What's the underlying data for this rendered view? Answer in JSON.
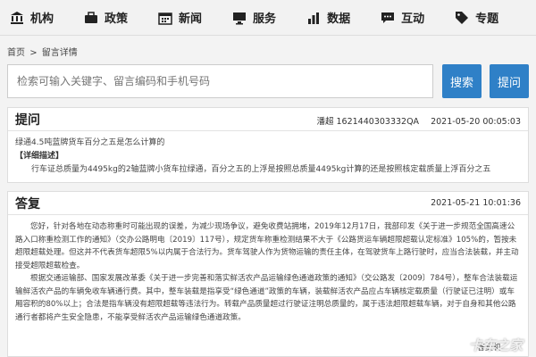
{
  "nav": {
    "items": [
      {
        "label": "机构",
        "icon": "institution-icon"
      },
      {
        "label": "政策",
        "icon": "briefcase-icon"
      },
      {
        "label": "新闻",
        "icon": "calendar-icon"
      },
      {
        "label": "服务",
        "icon": "monitor-icon"
      },
      {
        "label": "数据",
        "icon": "bar-chart-icon"
      },
      {
        "label": "互动",
        "icon": "chat-bubble-icon"
      },
      {
        "label": "专题",
        "icon": "tag-icon"
      }
    ]
  },
  "breadcrumb": {
    "home": "首页",
    "sep": ">",
    "current": "留言详情"
  },
  "search": {
    "placeholder": "检索可输入关键字、留言编码和手机号码",
    "search_label": "搜索",
    "ask_label": "提问"
  },
  "question": {
    "heading": "提问",
    "code": "潘超 1621440303332QA",
    "date": "2021-05-20 00:05:03",
    "title": "绿通4.5吨蓝牌货车百分之五是怎么计算的",
    "desc_label": "【详细描述】",
    "desc": "行车证总质量为4495kg的2轴蓝牌小货车拉绿通，百分之五的上浮是按照总质量4495kg计算的还是按照核定载质量上浮百分之五"
  },
  "answer": {
    "heading": "答复",
    "date": "2021-05-21 10:01:36",
    "paragraphs": [
      "您好，针对各地在动态称重时可能出现的误差，为减少现场争议，避免收费站拥堵，2019年12月17日，我部印发《关于进一步规范全国高速公路入口称重检测工作的通知》（交办公路明电〔2019〕117号），规定货车称重检测结果不大于《公路货运车辆超限超载认定标准》105%的，暂按未超限超载处理。但这并不代表货车超限5%以内属于合法行为。货车驾驶人作为货物运输的责任主体，在驾驶货车上路行驶时，应当合法装载，并主动接受超限超载检查。",
      "根据交通运输部、国家发展改革委《关于进一步完善和落实鲜活农产品运输绿色通道政策的通知》（交公路发〔2009〕784号），整车合法装载运输鲜活农产品的车辆免收车辆通行费。其中，整车装载是指享受“绿色通道”政策的车辆，装载鲜活农产品应占车辆核定载质量（行驶证已注明）或车厢容积的80%以上；合法是指车辆没有超限超载等违法行为。转载产品质量超过行驶证注明总质量的，属于违法超限超载车辆，对于自身和其他公路通行者都将产生安全隐患，不能享受鲜活农产品运输绿色通道政策。"
    ],
    "footer": "答复机",
    "watermark": "卡车之家"
  }
}
